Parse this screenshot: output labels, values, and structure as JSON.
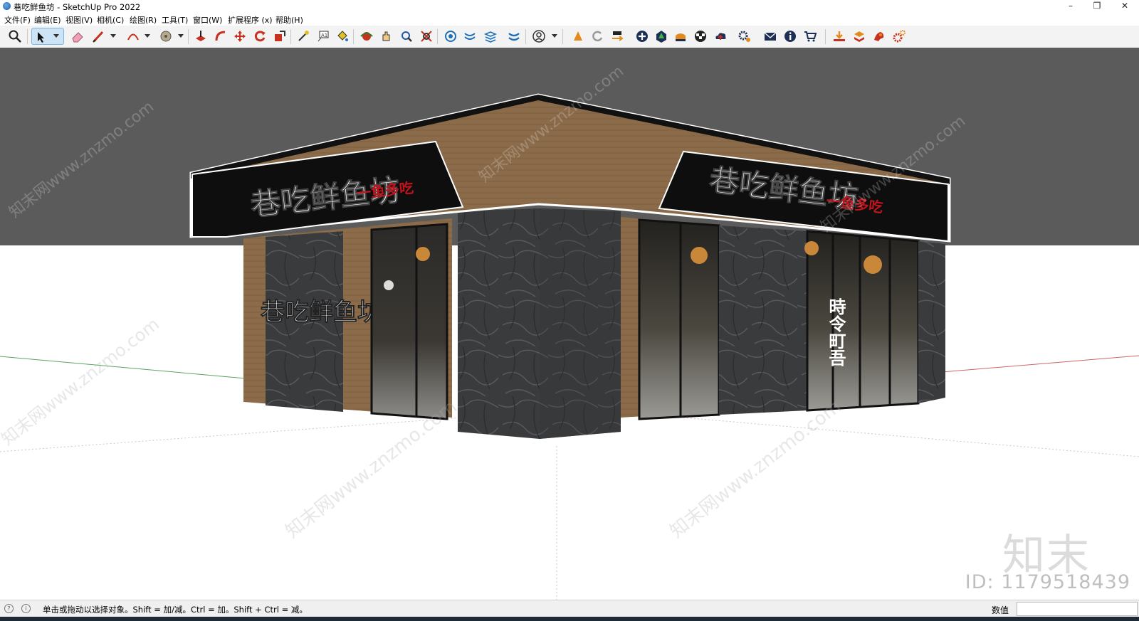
{
  "window": {
    "title": "巷吃鲜鱼坊 - SketchUp Pro 2022",
    "controls": {
      "minimize": "–",
      "restore": "❐",
      "close": "✕"
    }
  },
  "menu": [
    "文件(F)",
    "编辑(E)",
    "视图(V)",
    "相机(C)",
    "绘图(R)",
    "工具(T)",
    "窗口(W)",
    "扩展程序 (x)",
    "帮助(H)"
  ],
  "toolbar": {
    "tools": [
      "zoom-icon",
      "select-icon",
      "eraser-icon",
      "pencil-icon",
      "arc-icon",
      "circle-icon",
      "push-pull-icon",
      "follow-me-icon",
      "move-icon",
      "rotate-icon",
      "scale-icon",
      "tape-measure-icon",
      "text-icon",
      "paint-bucket-icon",
      "orbit-icon",
      "pan-icon",
      "zoom-window-icon",
      "zoom-extents-icon",
      "components-icon",
      "materials-icon",
      "layers-icon",
      "styles-icon",
      "account-icon",
      "extension-warehouse-icon",
      "refresh-icon",
      "swap-icon",
      "add-icon",
      "tree-icon",
      "chart-icon",
      "checker-icon",
      "cloud-icon",
      "settings-icon",
      "mail-icon",
      "info-icon",
      "cart-icon",
      "download-icon",
      "layers-red-icon",
      "paint-red-icon",
      "gear-red-icon"
    ],
    "selected_tool": "select-icon"
  },
  "scene": {
    "sign_text": "巷吃鲜鱼坊",
    "sign_slogan": "一鱼多吃",
    "window_text": "時令町吾",
    "colors": {
      "sky": "#5b5b5b",
      "ground": "#ffffff",
      "wood": "#8a6a48",
      "stone": "#3a3b3d",
      "sign_bg": "#0e0e0e",
      "slogan": "#c0141c"
    }
  },
  "watermark": {
    "logo": "知末",
    "id": "ID: 1179518439",
    "diagonal": "知末网www.znzmo.com"
  },
  "status": {
    "message": "单击或拖动以选择对象。Shift = 加/减。Ctrl = 加。Shift + Ctrl = 减。",
    "measurement_label": "数值",
    "measurement_value": ""
  }
}
